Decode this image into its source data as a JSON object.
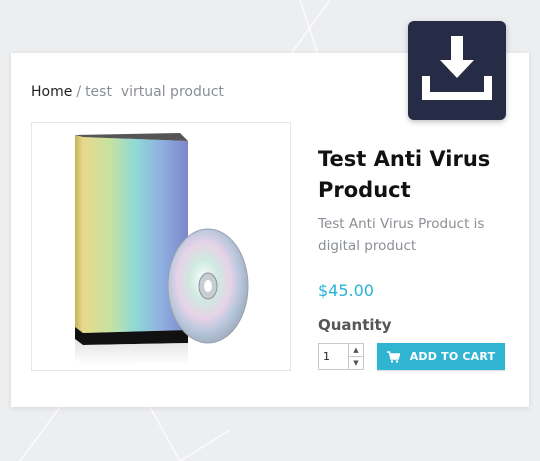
{
  "breadcrumb": {
    "home": "Home",
    "separator": "/",
    "current": "test  virtual product"
  },
  "product": {
    "title": "Test Anti Virus Product",
    "description": "Test Anti Virus Product is digital product",
    "price": "$45.00",
    "quantity_label": "Quantity",
    "quantity_value": "1",
    "add_to_cart_label": "ADD TO CART",
    "image": "software-box-with-disc"
  },
  "icons": {
    "download": "download-icon",
    "cart": "shopping-cart-icon",
    "spin_up": "chevron-up-icon",
    "spin_down": "chevron-down-icon"
  },
  "colors": {
    "accent": "#2fb5d2",
    "price": "#27b4d6",
    "badge_bg": "#262c45"
  }
}
